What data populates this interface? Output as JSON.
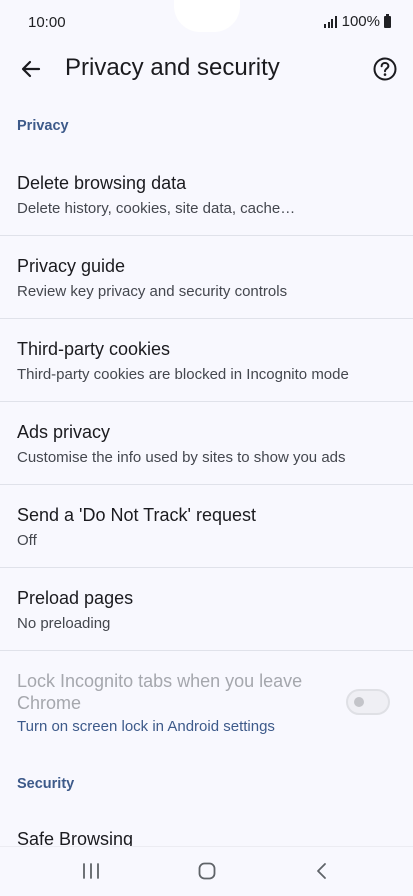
{
  "status": {
    "time": "10:00",
    "battery": "100%"
  },
  "toolbar": {
    "title": "Privacy and security",
    "back_icon": "arrow-left-icon",
    "help_icon": "help-circle-icon"
  },
  "sections": {
    "privacy_header": "Privacy",
    "security_header": "Security"
  },
  "items": [
    {
      "title": "Delete browsing data",
      "subtitle": "Delete history, cookies, site data, cache…"
    },
    {
      "title": "Privacy guide",
      "subtitle": "Review key privacy and security controls"
    },
    {
      "title": "Third-party cookies",
      "subtitle": "Third-party cookies are blocked in Incognito mode"
    },
    {
      "title": "Ads privacy",
      "subtitle": "Customise the info used by sites to show you ads"
    },
    {
      "title": "Send a 'Do Not Track' request",
      "subtitle": "Off"
    },
    {
      "title": "Preload pages",
      "subtitle": "No preloading"
    }
  ],
  "lock_incognito": {
    "title": "Lock Incognito tabs when you leave Chrome",
    "subtitle": "Turn on screen lock in Android settings",
    "toggle_on": false,
    "enabled": false
  },
  "security_items": [
    {
      "title": "Safe Browsing"
    }
  ],
  "colors": {
    "background": "#f8f8fe",
    "accent": "#3d5a8a",
    "disabled_text": "#a5a7ad"
  }
}
